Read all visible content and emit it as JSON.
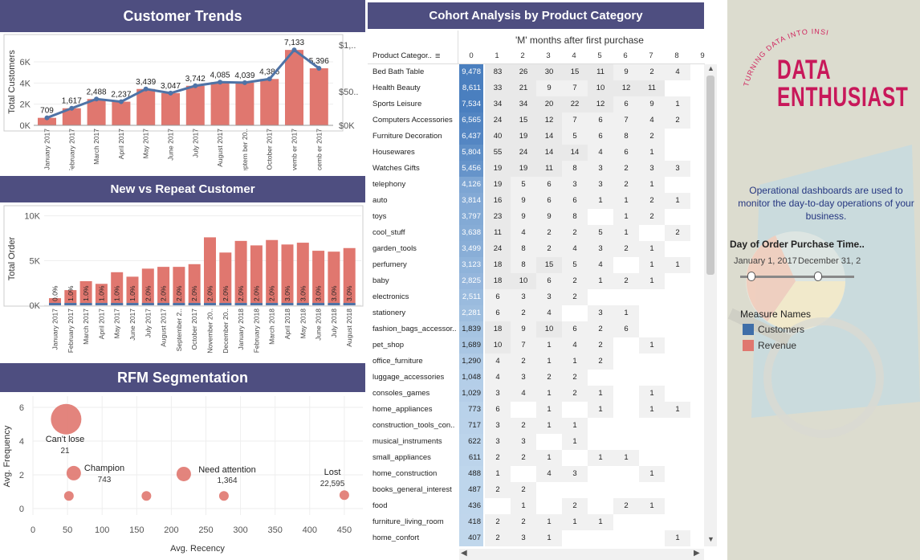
{
  "customer_trends": {
    "title": "Customer Trends",
    "ylabel": "Total Customers",
    "yticks": [
      "6K",
      "4K",
      "2K",
      "0K"
    ],
    "y2ticks": [
      "$1,..",
      "$50..",
      "$0K"
    ],
    "months": [
      "January 2017",
      "February 2017",
      "March 2017",
      "April 2017",
      "May 2017",
      "June 2017",
      "July 2017",
      "August 2017",
      "Septem ber 20..",
      "October 2017",
      "Novemb er 2017",
      "Decemb er 2017"
    ],
    "customers": [
      709,
      1617,
      2488,
      2237,
      3439,
      3047,
      3742,
      4085,
      4039,
      4386,
      7133,
      5396
    ],
    "revenue": [
      709,
      1617,
      2488,
      2237,
      3439,
      3047,
      3742,
      4085,
      4039,
      4386,
      7133,
      5396
    ],
    "labels": [
      "709",
      "1,617",
      "2,488",
      "2,237",
      "3,439",
      "3,047",
      "3,742",
      "4,085",
      "4,039",
      "4,386",
      "7,133",
      "5,396"
    ]
  },
  "new_repeat": {
    "title": "New vs Repeat Customer",
    "ylabel": "Total Order",
    "yticks": [
      "10K",
      "5K",
      "0K"
    ],
    "months": [
      "January 2017",
      "February 2017",
      "March 2017",
      "April 2017",
      "May 2017",
      "June 2017",
      "July 2017",
      "August 2017",
      "September 2..",
      "October 2017",
      "November 20..",
      "December 20..",
      "January 2018",
      "February 2018",
      "March 2018",
      "April 2018",
      "May 2018",
      "June 2018",
      "July 2018",
      "August 2018"
    ],
    "orders": [
      800,
      1700,
      2700,
      2400,
      3700,
      3200,
      4100,
      4300,
      4300,
      4600,
      7600,
      5900,
      7200,
      6700,
      7300,
      6800,
      7000,
      6100,
      6000,
      6400
    ],
    "repeat_pct": [
      "0.0%",
      "1.0%",
      "1.0%",
      "1.0%",
      "1.0%",
      "1.0%",
      "2.0%",
      "2.0%",
      "2.0%",
      "2.0%",
      "2.0%",
      "2.0%",
      "2.0%",
      "2.0%",
      "2.0%",
      "3.0%",
      "3.0%",
      "3.0%",
      "3.0%",
      "3.0%"
    ]
  },
  "rfm": {
    "title": "RFM Segmentation",
    "xlabel": "Avg. Recency",
    "ylabel": "Avg. Frequency",
    "xticks": [
      "0",
      "50",
      "100",
      "150",
      "200",
      "250",
      "300",
      "350",
      "400",
      "450"
    ],
    "yticks": [
      "6",
      "4",
      "2",
      "0"
    ],
    "segments": [
      {
        "name": "Can't lose",
        "count": "21"
      },
      {
        "name": "Champion",
        "count": "743"
      },
      {
        "name": "Need attention",
        "count": "1,364"
      },
      {
        "name": "Lost",
        "count": "22,595"
      }
    ]
  },
  "cohort": {
    "title": "Cohort Analysis by Product Category",
    "axis_label": "'M' months after first purchase",
    "col_header": "Product Categor..",
    "months": [
      "0",
      "1",
      "2",
      "3",
      "4",
      "5",
      "6",
      "7",
      "8",
      "9"
    ],
    "rows": [
      [
        "Bed Bath Table",
        "9,478",
        "83",
        "26",
        "30",
        "15",
        "11",
        "9",
        "2",
        "4"
      ],
      [
        "Health Beauty",
        "8,611",
        "33",
        "21",
        "9",
        "7",
        "10",
        "12",
        "11",
        ""
      ],
      [
        "Sports Leisure",
        "7,534",
        "34",
        "34",
        "20",
        "22",
        "12",
        "6",
        "9",
        "1"
      ],
      [
        "Computers Accessories",
        "6,565",
        "24",
        "15",
        "12",
        "7",
        "6",
        "7",
        "4",
        "2"
      ],
      [
        "Furniture Decoration",
        "6,437",
        "40",
        "19",
        "14",
        "5",
        "6",
        "8",
        "2",
        ""
      ],
      [
        "Housewares",
        "5,804",
        "55",
        "24",
        "14",
        "14",
        "4",
        "6",
        "1",
        ""
      ],
      [
        "Watches Gifts",
        "5,456",
        "19",
        "19",
        "11",
        "8",
        "3",
        "2",
        "3",
        "3"
      ],
      [
        "telephony",
        "4,126",
        "19",
        "5",
        "6",
        "3",
        "3",
        "2",
        "1",
        ""
      ],
      [
        "auto",
        "3,814",
        "16",
        "9",
        "6",
        "6",
        "1",
        "1",
        "2",
        "1"
      ],
      [
        "toys",
        "3,797",
        "23",
        "9",
        "9",
        "8",
        "",
        "1",
        "2",
        ""
      ],
      [
        "cool_stuff",
        "3,638",
        "11",
        "4",
        "2",
        "2",
        "5",
        "1",
        "",
        "2"
      ],
      [
        "garden_tools",
        "3,499",
        "24",
        "8",
        "2",
        "4",
        "3",
        "2",
        "1",
        ""
      ],
      [
        "perfumery",
        "3,123",
        "18",
        "8",
        "15",
        "5",
        "4",
        "",
        "1",
        "1"
      ],
      [
        "baby",
        "2,825",
        "18",
        "10",
        "6",
        "2",
        "1",
        "2",
        "1",
        ""
      ],
      [
        "electronics",
        "2,511",
        "6",
        "3",
        "3",
        "2",
        "",
        "",
        "",
        ""
      ],
      [
        "stationery",
        "2,281",
        "6",
        "2",
        "4",
        "",
        "3",
        "1",
        "",
        ""
      ],
      [
        "fashion_bags_accessor..",
        "1,839",
        "18",
        "9",
        "10",
        "6",
        "2",
        "6",
        "",
        ""
      ],
      [
        "pet_shop",
        "1,689",
        "10",
        "7",
        "1",
        "4",
        "2",
        "",
        "1",
        ""
      ],
      [
        "office_furniture",
        "1,290",
        "4",
        "2",
        "1",
        "1",
        "2",
        "",
        "",
        ""
      ],
      [
        "luggage_accessories",
        "1,048",
        "4",
        "3",
        "2",
        "2",
        "",
        "",
        "",
        ""
      ],
      [
        "consoles_games",
        "1,029",
        "3",
        "4",
        "1",
        "2",
        "1",
        "",
        "1",
        ""
      ],
      [
        "home_appliances",
        "773",
        "6",
        "",
        "1",
        "",
        "1",
        "",
        "1",
        "1"
      ],
      [
        "construction_tools_con..",
        "717",
        "3",
        "2",
        "1",
        "1",
        "",
        "",
        "",
        ""
      ],
      [
        "musical_instruments",
        "622",
        "3",
        "3",
        "",
        "1",
        "",
        "",
        "",
        ""
      ],
      [
        "small_appliances",
        "611",
        "2",
        "2",
        "1",
        "",
        "1",
        "1",
        "",
        ""
      ],
      [
        "home_construction",
        "488",
        "1",
        "",
        "4",
        "3",
        "",
        "",
        "1",
        ""
      ],
      [
        "books_general_interest",
        "487",
        "2",
        "2",
        "",
        "",
        "",
        "",
        "",
        ""
      ],
      [
        "food",
        "436",
        "",
        "1",
        "",
        "2",
        "",
        "2",
        "1",
        ""
      ],
      [
        "furniture_living_room",
        "418",
        "2",
        "2",
        "1",
        "1",
        "1",
        "",
        "",
        ""
      ],
      [
        "home_confort",
        "407",
        "2",
        "3",
        "1",
        "",
        "",
        "",
        "",
        "1"
      ]
    ]
  },
  "panel": {
    "brand_top": "TURNING DATA INTO INSIGHTS",
    "brand_line1": "DATA",
    "brand_line2": "ENTHUSIAST",
    "description": "Operational dashboards are used to monitor the day-to-day operations of your business.",
    "filter_title": "Day of Order Purchase Time..",
    "date_start": "January 1, 2017",
    "date_end": "December 31, 2",
    "legend_title": "Measure Names",
    "legend": [
      {
        "label": "Customers",
        "color": "#3f6ea8"
      },
      {
        "label": "Revenue",
        "color": "#e0776f"
      }
    ]
  },
  "colors": {
    "bar": "#e0776f",
    "line": "#4f73a6",
    "title_bg": "#4e4e80",
    "heat_dark": "#4a7fbf",
    "heat_light": "#c7dcef",
    "cell_gray": "#efefef"
  }
}
